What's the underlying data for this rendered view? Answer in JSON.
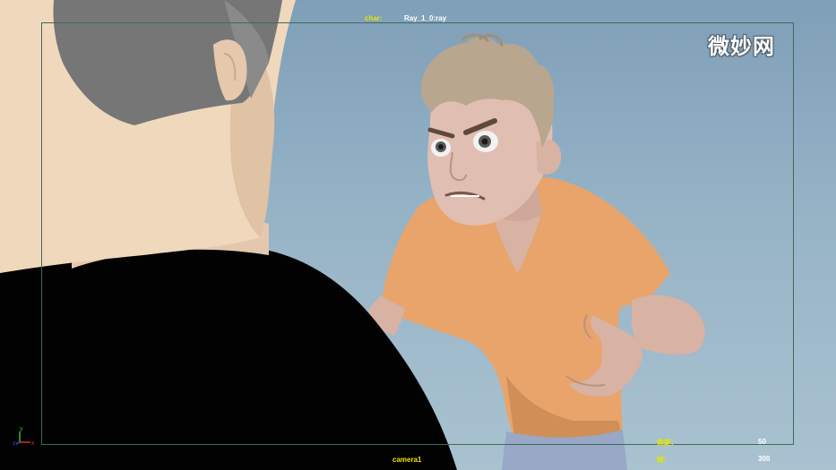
{
  "viewport": {
    "hud": {
      "char_label": "char:",
      "char_value": "Ray_1_0:ray",
      "camera_name": "camera1",
      "focal_label": "焦距:",
      "focal_value": "50",
      "frame_label": "帧:",
      "frame_value": "300"
    },
    "watermark": "微妙网",
    "axis_gizmo": {
      "x": "x",
      "y": "y",
      "z": "z"
    },
    "colors": {
      "background_top": "#7f9fb8",
      "background_bottom": "#a9c2d0",
      "hud_yellow": "#e6e600",
      "resolution_gate": "#3f6a5c"
    }
  }
}
